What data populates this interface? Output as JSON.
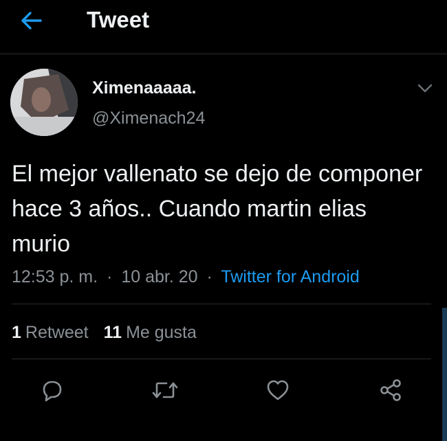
{
  "header": {
    "back_icon": "arrow-left-icon",
    "title": "Tweet"
  },
  "tweet": {
    "author": {
      "display_name": "Ximenaaaaa.",
      "handle": "@Ximenach24"
    },
    "text": "El mejor vallenato se dejo de componer hace 3 años.. Cuando martin elias murio",
    "time": "12:53 p. m.",
    "separator": "·",
    "date": "10 abr. 20",
    "source": "Twitter for Android",
    "stats": {
      "retweets_count": "1",
      "retweets_label": "Retweet",
      "likes_count": "11",
      "likes_label": "Me gusta"
    }
  },
  "actions": [
    "reply-icon",
    "retweet-icon",
    "like-icon",
    "share-icon"
  ],
  "colors": {
    "background": "#000000",
    "text": "#eef1f3",
    "muted": "#8b9196",
    "accent": "#1d9bf0",
    "divider": "#2a2d30"
  }
}
